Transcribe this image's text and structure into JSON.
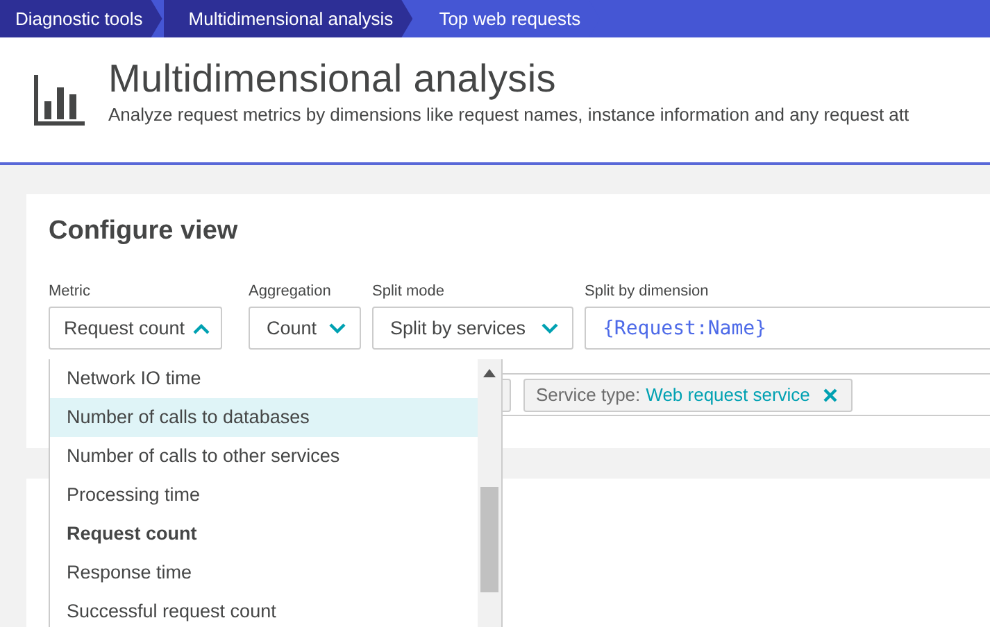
{
  "breadcrumbs": [
    {
      "label": "Diagnostic tools",
      "selected": false
    },
    {
      "label": "Multidimensional analysis",
      "selected": false
    },
    {
      "label": "Top web requests",
      "selected": true
    }
  ],
  "header": {
    "title": "Multidimensional analysis",
    "subtitle": "Analyze request metrics by dimensions like request names, instance information and any request att"
  },
  "configure_view": {
    "title": "Configure view",
    "metric": {
      "label": "Metric",
      "value": "Request count",
      "expanded": true,
      "options": [
        {
          "label": "Network IO time",
          "selected": false,
          "highlighted": false
        },
        {
          "label": "Number of calls to databases",
          "selected": false,
          "highlighted": true
        },
        {
          "label": "Number of calls to other services",
          "selected": false,
          "highlighted": false
        },
        {
          "label": "Processing time",
          "selected": false,
          "highlighted": false
        },
        {
          "label": "Request count",
          "selected": true,
          "highlighted": false
        },
        {
          "label": "Response time",
          "selected": false,
          "highlighted": false
        },
        {
          "label": "Successful request count",
          "selected": false,
          "highlighted": false
        }
      ]
    },
    "aggregation": {
      "label": "Aggregation",
      "value": "Count",
      "expanded": false
    },
    "split_mode": {
      "label": "Split mode",
      "value": "Split by services",
      "expanded": false
    },
    "split_by_dimension": {
      "label": "Split by dimension",
      "value": "{Request:Name}"
    },
    "filters": [
      {
        "label": "Service type:",
        "value": "Web request service"
      }
    ]
  }
}
